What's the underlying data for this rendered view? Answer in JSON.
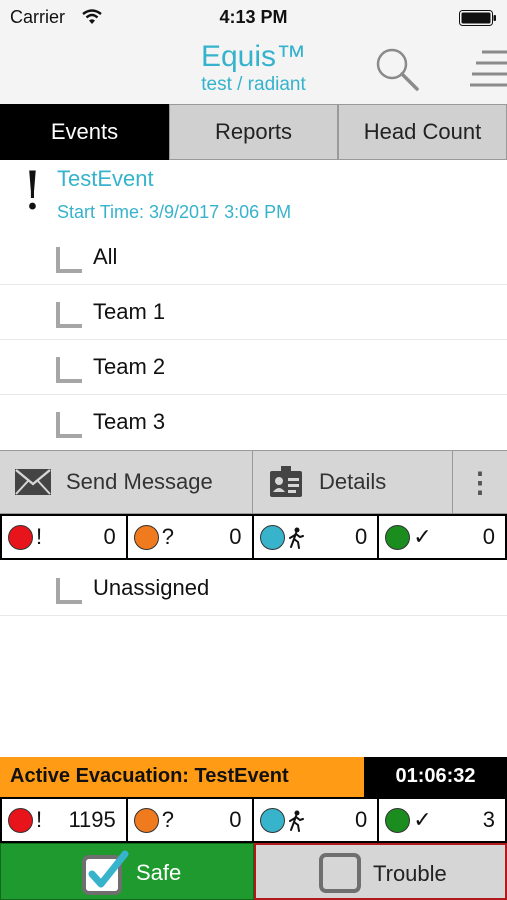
{
  "status_bar": {
    "carrier": "Carrier",
    "time": "4:13 PM"
  },
  "header": {
    "title": "Equis™",
    "subtitle": "test / radiant"
  },
  "tabs": [
    {
      "label": "Events",
      "active": true
    },
    {
      "label": "Reports",
      "active": false
    },
    {
      "label": "Head Count",
      "active": false
    }
  ],
  "event": {
    "name": "TestEvent",
    "start_time": "Start Time: 3/9/2017 3:06 PM"
  },
  "teams": [
    "All",
    "Team 1",
    "Team 2",
    "Team 3"
  ],
  "actions": {
    "send_message": "Send Message",
    "details": "Details",
    "more": "⋮"
  },
  "counts_team": [
    {
      "color": "#e8141b",
      "symbol": "!",
      "value": "0"
    },
    {
      "color": "#f07a1e",
      "symbol": "?",
      "value": "0"
    },
    {
      "color": "#37b4cc",
      "symbol": "walker",
      "value": "0"
    },
    {
      "color": "#1b8d1f",
      "symbol": "✓",
      "value": "0"
    }
  ],
  "unassigned": {
    "label": "Unassigned"
  },
  "evacuation": {
    "label": "Active Evacuation: TestEvent",
    "timer": "01:06:32"
  },
  "counts_total": [
    {
      "color": "#e8141b",
      "symbol": "!",
      "value": "1195"
    },
    {
      "color": "#f07a1e",
      "symbol": "?",
      "value": "0"
    },
    {
      "color": "#37b4cc",
      "symbol": "walker",
      "value": "0"
    },
    {
      "color": "#1b8d1f",
      "symbol": "✓",
      "value": "3"
    }
  ],
  "buttons": {
    "safe": "Safe",
    "trouble": "Trouble"
  },
  "colors": {
    "accent": "#36b3cc",
    "safe": "#1e9a2e",
    "evac": "#ff9b14",
    "trouble_border": "#b01a1a"
  }
}
